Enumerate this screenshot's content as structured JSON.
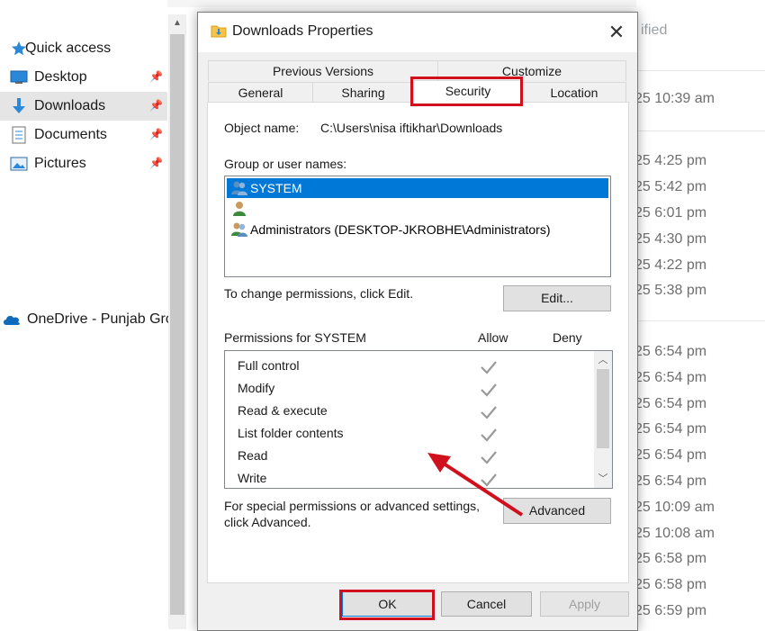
{
  "explorer": {
    "nav": [
      {
        "label": "Quick access",
        "icon": "star-icon"
      },
      {
        "label": "Desktop",
        "icon": "desktop-icon"
      },
      {
        "label": "Downloads",
        "icon": "download-arrow-icon"
      },
      {
        "label": "Documents",
        "icon": "document-icon"
      },
      {
        "label": "Pictures",
        "icon": "pictures-icon"
      },
      {
        "label": "OneDrive - Punjab Gro",
        "icon": "onedrive-cloud-icon"
      }
    ],
    "column_header": "ified",
    "dates": [
      "25 10:39 am",
      "25 4:25 pm",
      "25 5:42 pm",
      "25 6:01 pm",
      "25 4:30 pm",
      "25 4:22 pm",
      "25 5:38 pm",
      "25 6:54 pm",
      "25 6:54 pm",
      "25 6:54 pm",
      "25 6:54 pm",
      "25 6:54 pm",
      "25 6:54 pm",
      "25 10:09 am",
      "25 10:08 am",
      "25 6:58 pm",
      "25 6:58 pm",
      "25 6:59 pm"
    ]
  },
  "dialog": {
    "title": "Downloads Properties",
    "close_glyph": "✕",
    "tabs_top": [
      "Previous Versions",
      "Customize"
    ],
    "tabs_bottom": [
      "General",
      "Sharing",
      "Security",
      "Location"
    ],
    "active_tab": "Security",
    "object_name_label": "Object name:",
    "object_name_value": "C:\\Users\\nisa iftikhar\\Downloads",
    "group_label": "Group or user names:",
    "users": [
      {
        "name": "SYSTEM",
        "selected": true
      },
      {
        "name": "",
        "selected": false
      },
      {
        "name": "Administrators (DESKTOP-JKROBHE\\Administrators)",
        "selected": false
      }
    ],
    "change_text": "To change permissions, click Edit.",
    "edit_button": "Edit...",
    "permissions_label": "Permissions for SYSTEM",
    "allow_header": "Allow",
    "deny_header": "Deny",
    "permissions": [
      {
        "name": "Full control",
        "allow": true,
        "deny": false
      },
      {
        "name": "Modify",
        "allow": true,
        "deny": false
      },
      {
        "name": "Read & execute",
        "allow": true,
        "deny": false
      },
      {
        "name": "List folder contents",
        "allow": true,
        "deny": false
      },
      {
        "name": "Read",
        "allow": true,
        "deny": false
      },
      {
        "name": "Write",
        "allow": true,
        "deny": false
      }
    ],
    "advanced_text_line1": "For special permissions or advanced settings,",
    "advanced_text_line2": "click Advanced.",
    "advanced_button": "Advanced",
    "ok_button": "OK",
    "cancel_button": "Cancel",
    "apply_button": "Apply"
  },
  "colors": {
    "annotation_red": "#d0101c",
    "selection_blue": "#0078d7",
    "check_gray": "#9a9a9a"
  }
}
